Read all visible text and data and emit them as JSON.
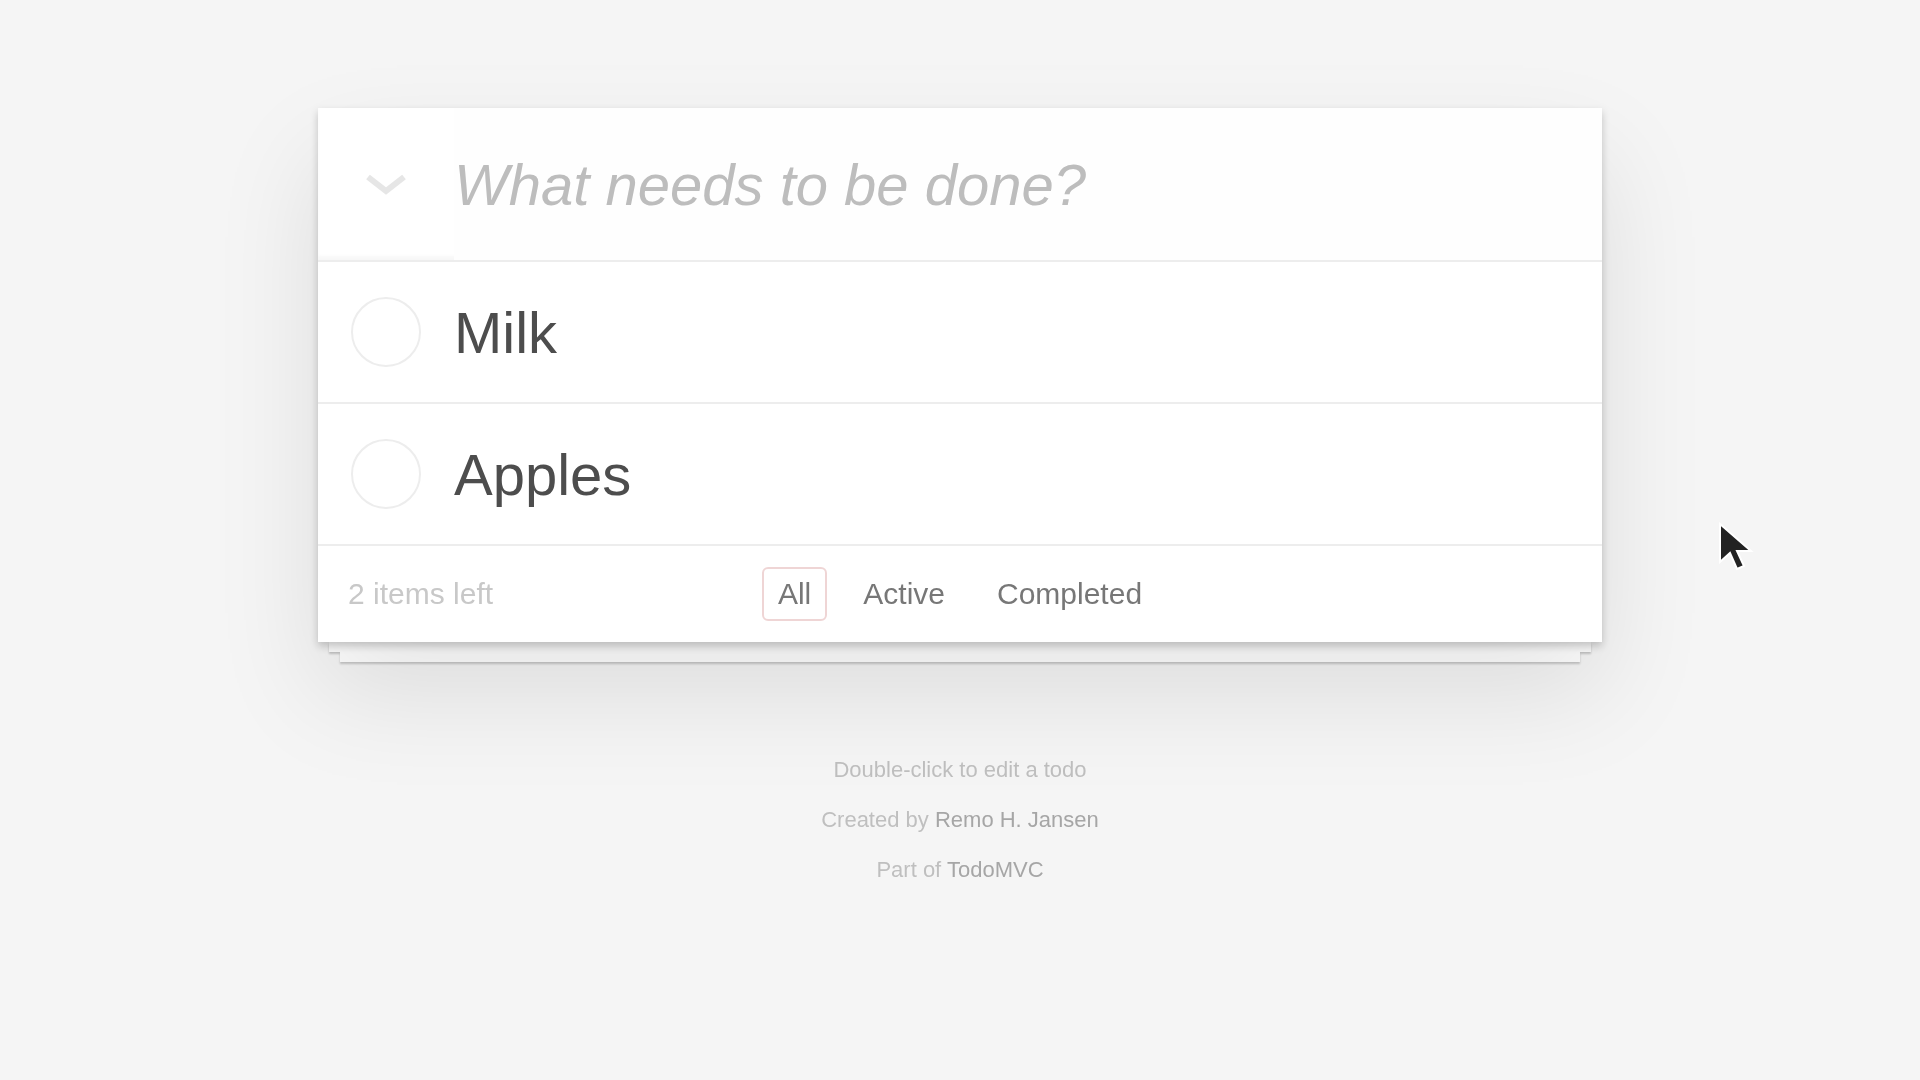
{
  "new_todo": {
    "placeholder": "What needs to be done?"
  },
  "todos": [
    {
      "title": "Milk",
      "completed": false
    },
    {
      "title": "Apples",
      "completed": false
    }
  ],
  "footer": {
    "count": "2 items left",
    "filters": [
      {
        "label": "All",
        "selected": true
      },
      {
        "label": "Active",
        "selected": false
      },
      {
        "label": "Completed",
        "selected": false
      }
    ]
  },
  "info": [
    {
      "kind": "text",
      "text": "Double-click to edit a todo"
    },
    {
      "kind": "credit",
      "prefix": "Created by",
      "link": "Remo H. Jansen"
    },
    {
      "kind": "credit",
      "prefix": "Part of",
      "link": "TodoMVC"
    }
  ]
}
